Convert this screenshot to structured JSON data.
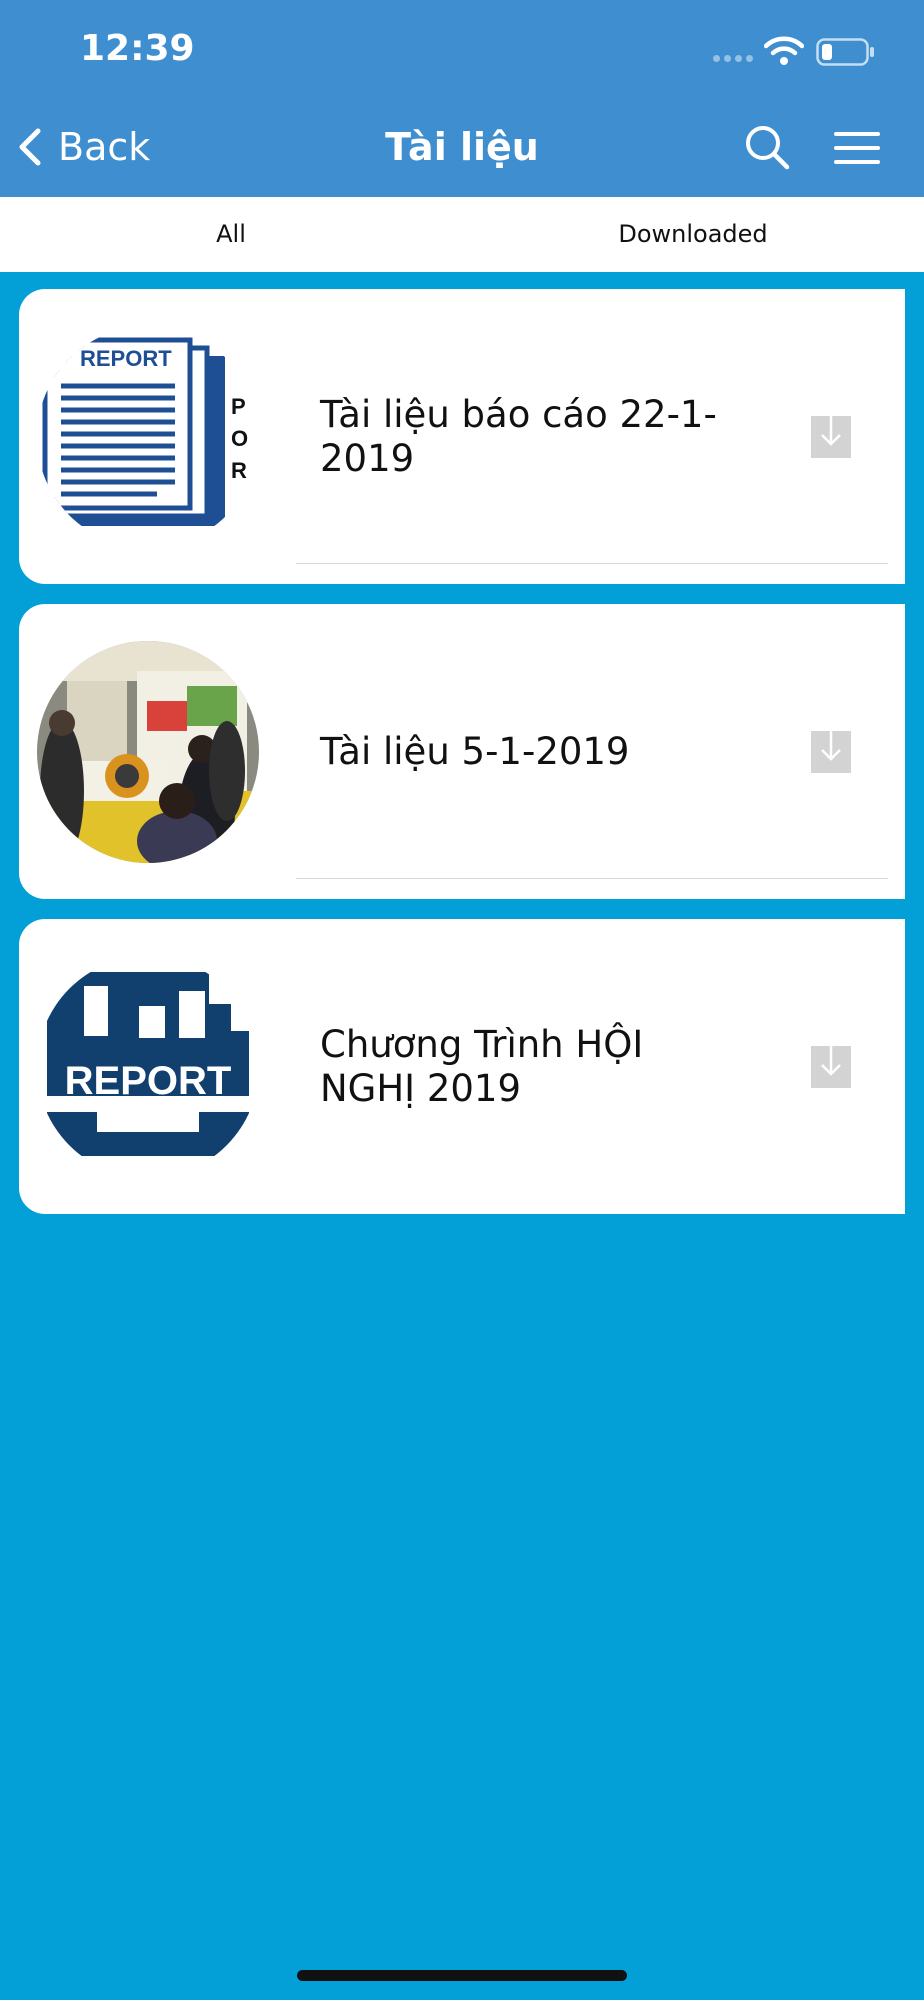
{
  "status_bar": {
    "time": "12:39"
  },
  "nav": {
    "back_label": "Back",
    "title": "Tài liệu"
  },
  "tabs": [
    {
      "label": "All"
    },
    {
      "label": "Downloaded"
    }
  ],
  "documents": [
    {
      "title": "Tài liệu báo cáo 22-1-2019",
      "thumb_text": "REPORT",
      "side_letters": "POR",
      "thumb_icon": "report-document-icon"
    },
    {
      "title": "Tài liệu 5-1-2019",
      "thumb_icon": "conference-photo"
    },
    {
      "title": "Chương Trình HỘI NGHỊ 2019",
      "thumb_text": "REPORT",
      "thumb_icon": "report-building-icon"
    }
  ],
  "colors": {
    "header": "#3f8fd0",
    "background": "#039fd7",
    "report_blue": "#1e4f95",
    "report_navy": "#12406e"
  }
}
